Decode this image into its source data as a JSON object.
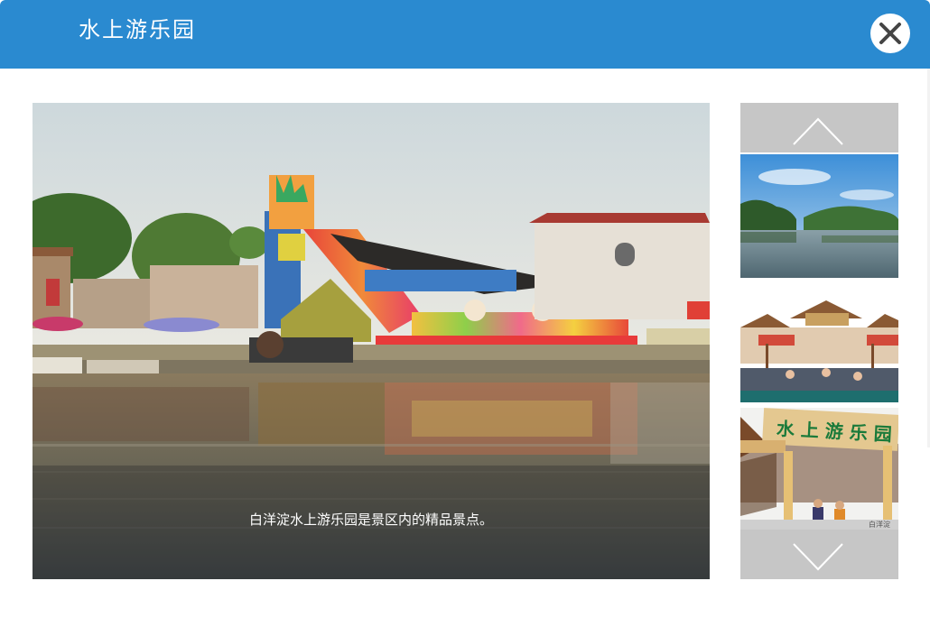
{
  "dialog": {
    "title": "水上游乐园",
    "close_icon": "close-icon"
  },
  "gallery": {
    "caption": "白洋淀水上游乐园是景区内的精品景点。",
    "up_icon": "chevron-up-icon",
    "down_icon": "chevron-down-icon",
    "thumb_sign_main": "水 上 游 乐 园",
    "thumb_sign_small": "白洋淀"
  },
  "colors": {
    "header": "#2a8ad0",
    "rail_button": "#c6c6c6"
  }
}
